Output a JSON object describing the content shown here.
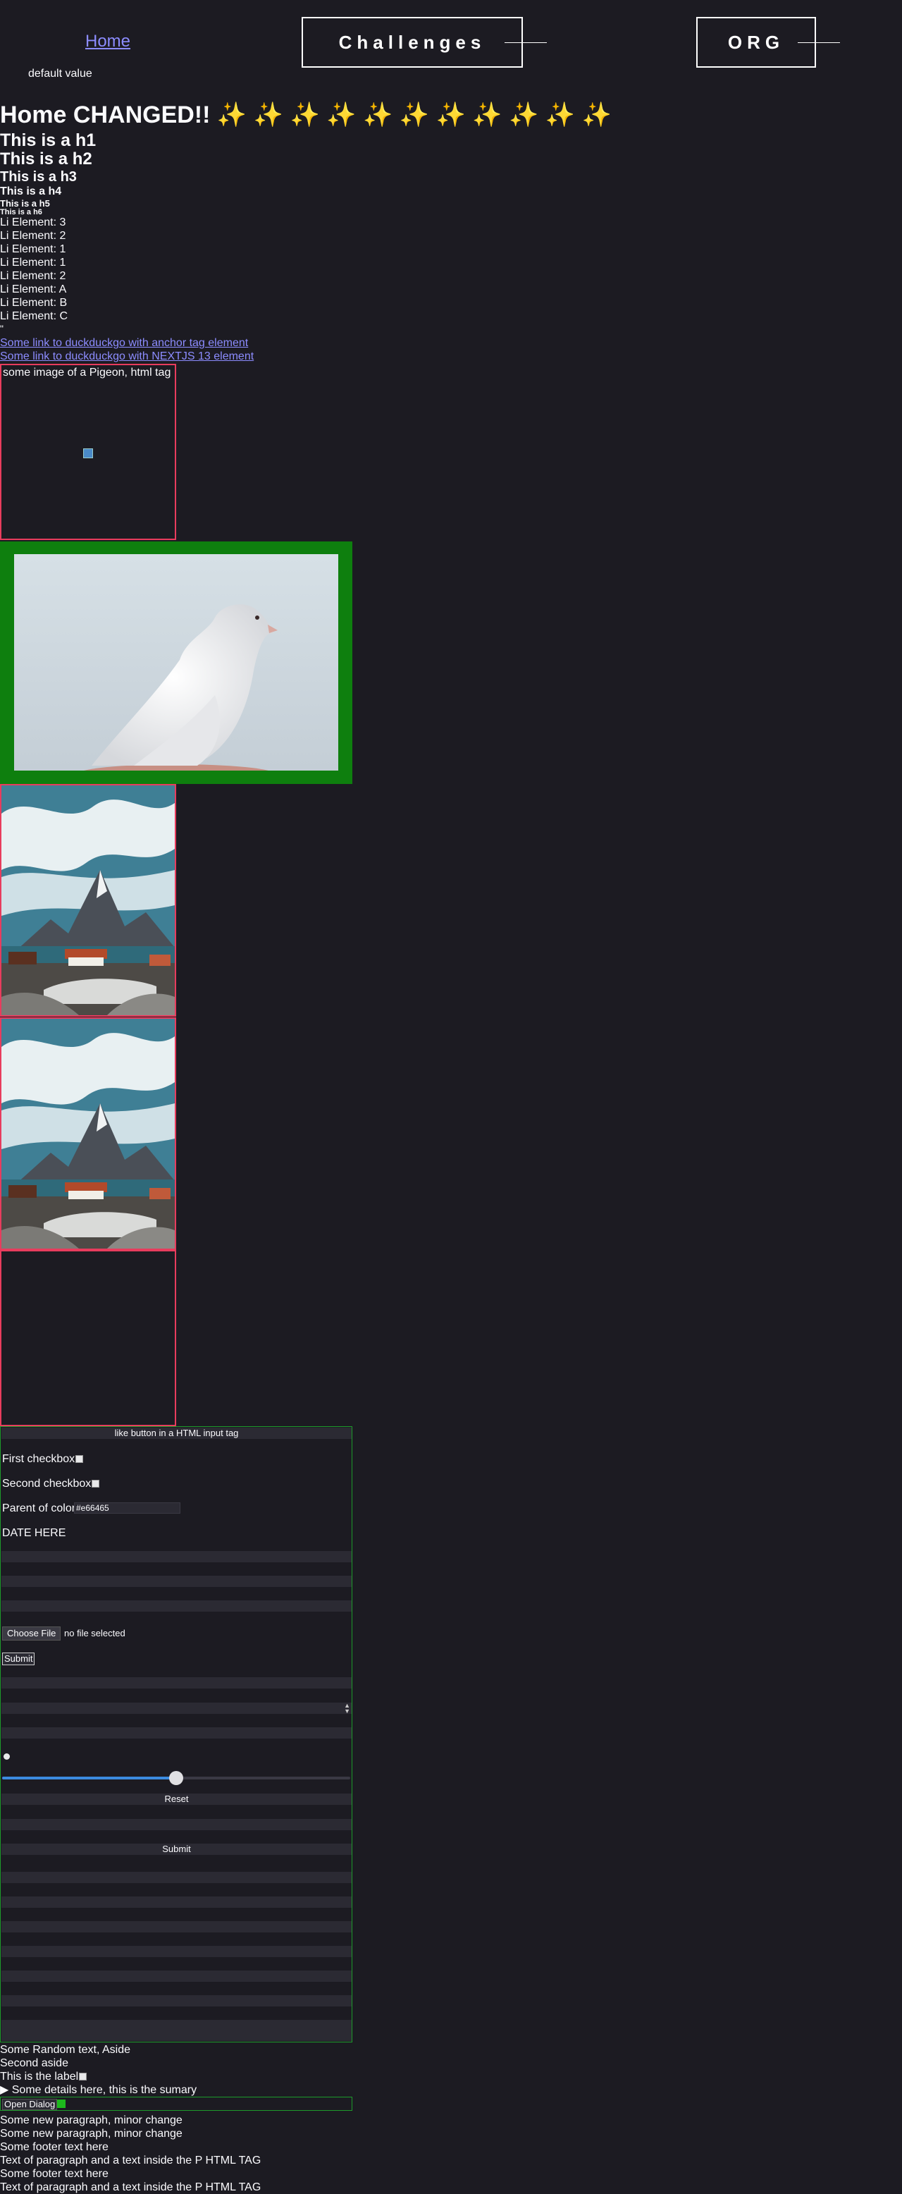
{
  "header": {
    "home_link": "Home",
    "challenges_button": "Challenges",
    "org_button": "ORG",
    "default_value": "default value"
  },
  "headings": {
    "main": "Home CHANGED!! ✨ ✨ ✨ ✨ ✨ ✨ ✨ ✨ ✨ ✨ ✨",
    "h1": "This is a h1",
    "h2": "This is a h2",
    "h3": "This is a h3",
    "h4": "This is a h4",
    "h5": "This is a h5",
    "h6": "This is a h6"
  },
  "list_items": [
    "Li Element: 3",
    "Li Element: 2",
    "Li Element: 1",
    "Li Element: 1",
    "Li Element: 2",
    "Li Element: A",
    "Li Element: B",
    "Li Element: C"
  ],
  "stray_quote": "\"",
  "links": {
    "anchor": "Some link to duckduckgo with anchor tag element",
    "nextjs": "Some link to duckduckgo with NEXTJS 13 element"
  },
  "images": {
    "pigeon_alt": "some image of a Pigeon, html tag"
  },
  "form": {
    "html_input_button": "like button in a HTML input tag",
    "first_checkbox": "First checkbox",
    "second_checkbox": "Second checkbox",
    "color_label": "Parent of color",
    "color_value": "#e66465",
    "date_label": "DATE HERE",
    "file_button": "Choose File",
    "file_status": "no file selected",
    "submit_small": "Submit",
    "range_value": 0.5,
    "reset_button": "Reset",
    "submit_button": "Submit"
  },
  "tail": {
    "aside_1": "Some Random text, Aside",
    "aside_2": "Second aside",
    "label": "This is the label",
    "details_summary": "▶  Some details here, this is the sumary",
    "dialog_button": "Open Dialog",
    "paragraph_1": "Some new paragraph, minor change",
    "paragraph_2": "Some new paragraph, minor change",
    "footer_1": "Some footer text here",
    "p_tag_1": "Text of paragraph and a text inside the P HTML TAG",
    "footer_2": "Some footer text here",
    "p_tag_2": "Text of paragraph and a text inside the P HTML TAG"
  },
  "colors": {
    "background": "#1c1b22",
    "link": "#8c8cff",
    "frame_red": "#e83c5d",
    "frame_green": "#0e7f0e",
    "range_accent": "#3b8be0"
  }
}
